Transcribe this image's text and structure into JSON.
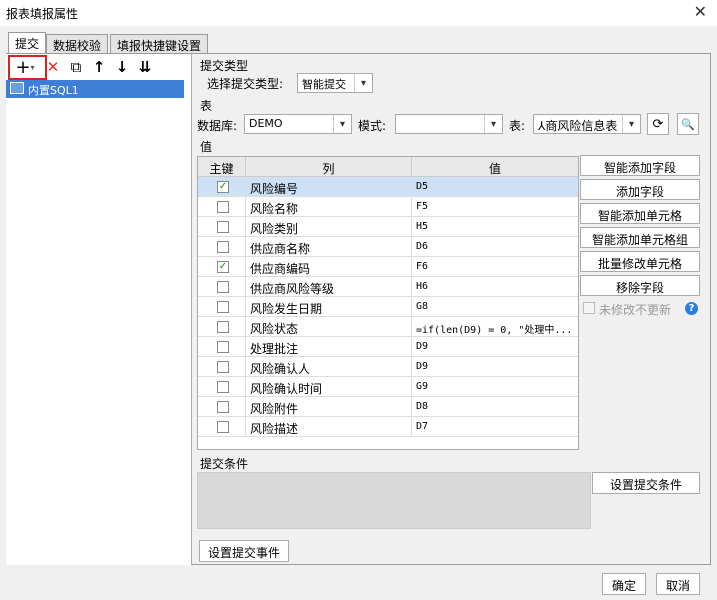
{
  "window": {
    "title": "报表填报属性",
    "close_glyph": "✕"
  },
  "tabs": [
    {
      "label": "提交"
    },
    {
      "label": "数据校验"
    },
    {
      "label": "填报快捷键设置"
    }
  ],
  "left_toolbar": {
    "add": "+",
    "add_caret": "▾",
    "delete": "✕",
    "copy": "⧉",
    "up": "↑",
    "down": "↓",
    "sort": "⇊"
  },
  "tree": {
    "items": [
      {
        "label": "内置SQL1"
      }
    ]
  },
  "submit_type": {
    "section": "提交类型",
    "label": "选择提交类型:",
    "value": "智能提交"
  },
  "table_section": {
    "section": "表",
    "db_label": "数据库:",
    "db_value": "DEMO",
    "mode_label": "模式:",
    "mode_value": "",
    "table_label": "表:",
    "table_value": "⅄商风险信息表",
    "refresh_glyph": "⟳",
    "preview_glyph": "🔍"
  },
  "values": {
    "section": "值",
    "headers": {
      "key": "主键",
      "column": "列",
      "value": "值"
    },
    "rows": [
      {
        "checked": true,
        "check_glyph": "✓",
        "column": "风险编号",
        "value": "D5"
      },
      {
        "checked": false,
        "check_glyph": "",
        "column": "风险名称",
        "value": "F5"
      },
      {
        "checked": false,
        "check_glyph": "",
        "column": "风险类别",
        "value": "H5"
      },
      {
        "checked": false,
        "check_glyph": "",
        "column": "供应商名称",
        "value": "D6"
      },
      {
        "checked": true,
        "check_glyph": "✓",
        "column": "供应商编码",
        "value": "F6"
      },
      {
        "checked": false,
        "check_glyph": "",
        "column": "供应商风险等级",
        "value": "H6"
      },
      {
        "checked": false,
        "check_glyph": "",
        "column": "风险发生日期",
        "value": "G8"
      },
      {
        "checked": false,
        "check_glyph": "",
        "column": "风险状态",
        "value": "=if(len(D9) = 0, \"处理中..."
      },
      {
        "checked": false,
        "check_glyph": "",
        "column": "处理批注",
        "value": "D9"
      },
      {
        "checked": false,
        "check_glyph": "",
        "column": "风险确认人",
        "value": "D9"
      },
      {
        "checked": false,
        "check_glyph": "",
        "column": "风险确认时间",
        "value": "G9"
      },
      {
        "checked": false,
        "check_glyph": "",
        "column": "风险附件",
        "value": "D8"
      },
      {
        "checked": false,
        "check_glyph": "",
        "column": "风险描述",
        "value": "D7"
      }
    ]
  },
  "right_buttons": [
    {
      "label": "智能添加字段"
    },
    {
      "label": "添加字段"
    },
    {
      "label": "智能添加单元格"
    },
    {
      "label": "智能添加单元格组"
    },
    {
      "label": "批量修改单元格"
    },
    {
      "label": "移除字段"
    }
  ],
  "unmodified": {
    "label": "未修改不更新",
    "help_glyph": "?"
  },
  "conditions": {
    "section": "提交条件",
    "button": "设置提交条件"
  },
  "event_button": "设置提交事件",
  "footer": {
    "ok": "确定",
    "cancel": "取消"
  },
  "colors": {
    "highlight_box": "#e02020",
    "selection": "#3d7fd6",
    "help": "#2a7de1"
  }
}
